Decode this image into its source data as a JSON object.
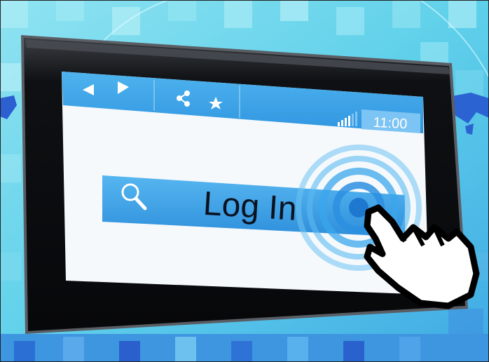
{
  "browser_bar": {
    "back_icon": "back-arrow-icon",
    "forward_icon": "forward-arrow-icon",
    "share_icon": "share-icon",
    "star_icon": "star-icon",
    "signal_icon": "signal-bars-icon",
    "clock": "11:00"
  },
  "login": {
    "search_icon": "search-icon",
    "label": "Log In"
  },
  "cursor_icon": "hand-pointer-icon",
  "colors": {
    "sky_blue": "#6fd6ea",
    "bar_blue": "#3aa4e6",
    "tablet_black": "#121416",
    "screen_white": "#f5f9fc",
    "cursor_black": "#000000"
  }
}
